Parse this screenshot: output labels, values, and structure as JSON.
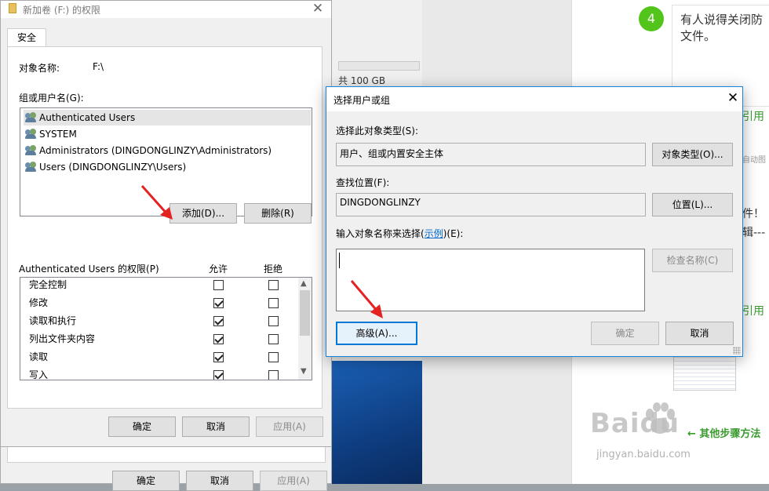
{
  "properties_dialog": {
    "title": "新加卷 (F:) 的权限",
    "tab_label": "安全",
    "object_name_label": "对象名称:",
    "object_name_value": "F:\\",
    "group_label": "组或用户名(G):",
    "users": [
      {
        "name": "Authenticated Users",
        "selected": true
      },
      {
        "name": "SYSTEM",
        "selected": false
      },
      {
        "name": "Administrators (DINGDONGLINZY\\Administrators)",
        "selected": false
      },
      {
        "name": "Users (DINGDONGLINZY\\Users)",
        "selected": false
      }
    ],
    "add_button": "添加(D)...",
    "remove_button": "删除(R)",
    "permissions_label": "Authenticated Users 的权限(P)",
    "allow_header": "允许",
    "deny_header": "拒绝",
    "permissions": [
      {
        "name": "完全控制",
        "allow": false,
        "deny": false
      },
      {
        "name": "修改",
        "allow": true,
        "deny": false
      },
      {
        "name": "读取和执行",
        "allow": true,
        "deny": false
      },
      {
        "name": "列出文件夹内容",
        "allow": true,
        "deny": false
      },
      {
        "name": "读取",
        "allow": true,
        "deny": false
      },
      {
        "name": "写入",
        "allow": true,
        "deny": false
      }
    ],
    "ok_button": "确定",
    "cancel_button": "取消",
    "apply_button": "应用(A)"
  },
  "behind_dialog": {
    "ok_button": "确定",
    "cancel_button": "取消",
    "apply_button": "应用(A)"
  },
  "select_dialog": {
    "title": "选择用户或组",
    "object_type_label": "选择此对象类型(S):",
    "object_type_value": "用户、组或内置安全主体",
    "object_type_button": "对象类型(O)...",
    "location_label": "查找位置(F):",
    "location_value": "DINGDONGLINZY",
    "location_button": "位置(L)...",
    "enter_label_prefix": "输入对象名称来选择(",
    "enter_label_link": "示例",
    "enter_label_suffix": ")(E):",
    "check_names_button": "检查名称(C)",
    "advanced_button": "高级(A)...",
    "ok_button": "确定",
    "cancel_button": "取消"
  },
  "background": {
    "disk_caption": "共 100 GB",
    "step_number": "4",
    "step_text_line1": "有人说得关闭防",
    "step_text_line2": "文件。",
    "quote_1": "引用",
    "quote_2": "引用",
    "fragment_1": "件！",
    "fragment_2": "辑---",
    "fragment_3": "自动图",
    "more_steps": "← 其他步骤方法",
    "watermark": "Baidu",
    "watermark_url": "jingyan.baidu.com"
  },
  "colors": {
    "accent": "#0078d7",
    "green": "#52c41a",
    "arrow_red": "#e52222"
  }
}
